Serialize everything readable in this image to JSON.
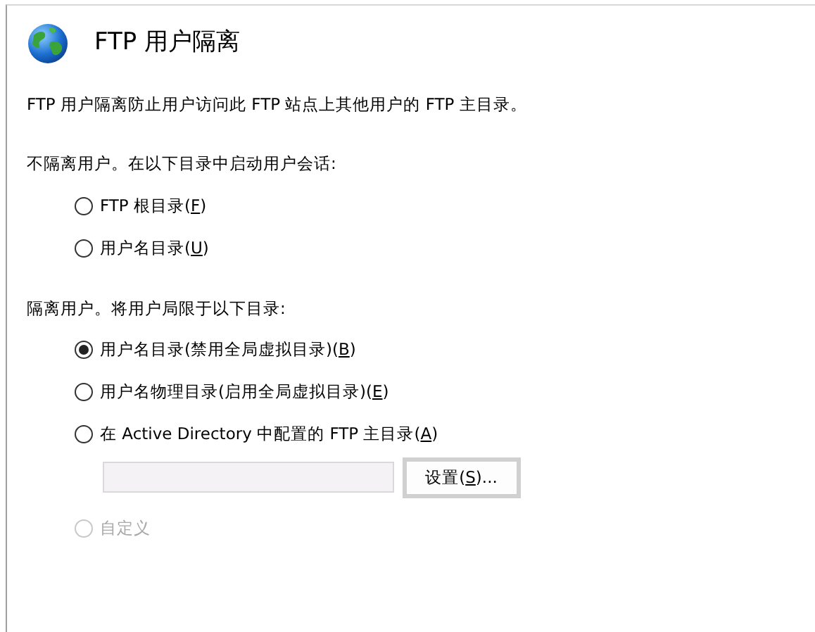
{
  "page": {
    "title": "FTP 用户隔离",
    "description": "FTP 用户隔离防止用户访问此 FTP 站点上其他用户的 FTP 主目录。"
  },
  "groups": [
    {
      "heading": "不隔离用户。在以下目录中启动用户会话:",
      "options": [
        {
          "before": "FTP 根目录(",
          "key": "F",
          "after": ")",
          "selected": false,
          "disabled": false
        },
        {
          "before": "用户名目录(",
          "key": "U",
          "after": ")",
          "selected": false,
          "disabled": false
        }
      ]
    },
    {
      "heading": "隔离用户。将用户局限于以下目录:",
      "options": [
        {
          "before": "用户名目录(禁用全局虚拟目录)(",
          "key": "B",
          "after": ")",
          "selected": true,
          "disabled": false
        },
        {
          "before": "用户名物理目录(启用全局虚拟目录)(",
          "key": "E",
          "after": ")",
          "selected": false,
          "disabled": false
        },
        {
          "before": "在 Active Directory 中配置的 FTP 主目录(",
          "key": "A",
          "after": ")",
          "selected": false,
          "disabled": false,
          "path_field": {
            "disabled": true
          },
          "settings_button": {
            "before": "设置(",
            "key": "S",
            "after": ")...",
            "disabled": false
          }
        },
        {
          "before": "自定义",
          "selected": false,
          "disabled": true
        }
      ]
    }
  ]
}
